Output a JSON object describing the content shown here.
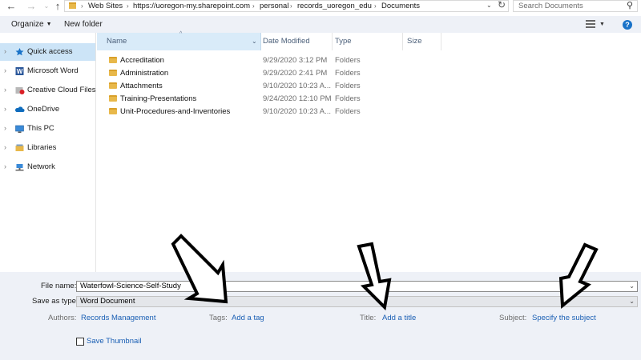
{
  "address_bar": {
    "breadcrumbs": [
      "Web Sites",
      "https://uoregon-my.sharepoint.com",
      "personal",
      "records_uoregon_edu",
      "Documents"
    ],
    "search_placeholder": "Search Documents"
  },
  "toolbar": {
    "organize_label": "Organize",
    "new_folder_label": "New folder"
  },
  "sidebar": {
    "items": [
      {
        "label": "Quick access",
        "icon": "star-icon",
        "selected": true
      },
      {
        "label": "Microsoft Word",
        "icon": "word-icon",
        "selected": false
      },
      {
        "label": "Creative Cloud Files",
        "icon": "creative-cloud-icon",
        "selected": false
      },
      {
        "label": "OneDrive",
        "icon": "cloud-icon",
        "selected": false
      },
      {
        "label": "This PC",
        "icon": "computer-icon",
        "selected": false
      },
      {
        "label": "Libraries",
        "icon": "library-icon",
        "selected": false
      },
      {
        "label": "Network",
        "icon": "network-icon",
        "selected": false
      }
    ]
  },
  "file_list": {
    "columns": [
      "Name",
      "Date Modified",
      "Type",
      "Size"
    ],
    "rows": [
      {
        "name": "Accreditation",
        "date": "9/29/2020 3:12 PM",
        "type": "Folders"
      },
      {
        "name": "Administration",
        "date": "9/29/2020 2:41 PM",
        "type": "Folders"
      },
      {
        "name": "Attachments",
        "date": "9/10/2020 10:23 A...",
        "type": "Folders"
      },
      {
        "name": "Training-Presentations",
        "date": "9/24/2020 12:10 PM",
        "type": "Folders"
      },
      {
        "name": "Unit-Procedures-and-Inventories",
        "date": "9/10/2020 10:23 A...",
        "type": "Folders"
      }
    ]
  },
  "save_panel": {
    "file_name_label": "File name:",
    "file_name_value": "Waterfowl-Science-Self-Study",
    "save_as_type_label": "Save as type:",
    "save_as_type_value": "Word Document",
    "authors_label": "Authors:",
    "authors_value": "Records Management",
    "tags_label": "Tags:",
    "tags_value": "Add a tag",
    "title_label": "Title:",
    "title_value": "Add a title",
    "subject_label": "Subject:",
    "subject_value": "Specify the subject",
    "save_thumbnail_label": "Save Thumbnail"
  },
  "colors": {
    "selection": "#cce4f7",
    "link": "#1a5fb4",
    "panel_background": "#eef1f7",
    "folder": "#e8b84a"
  }
}
